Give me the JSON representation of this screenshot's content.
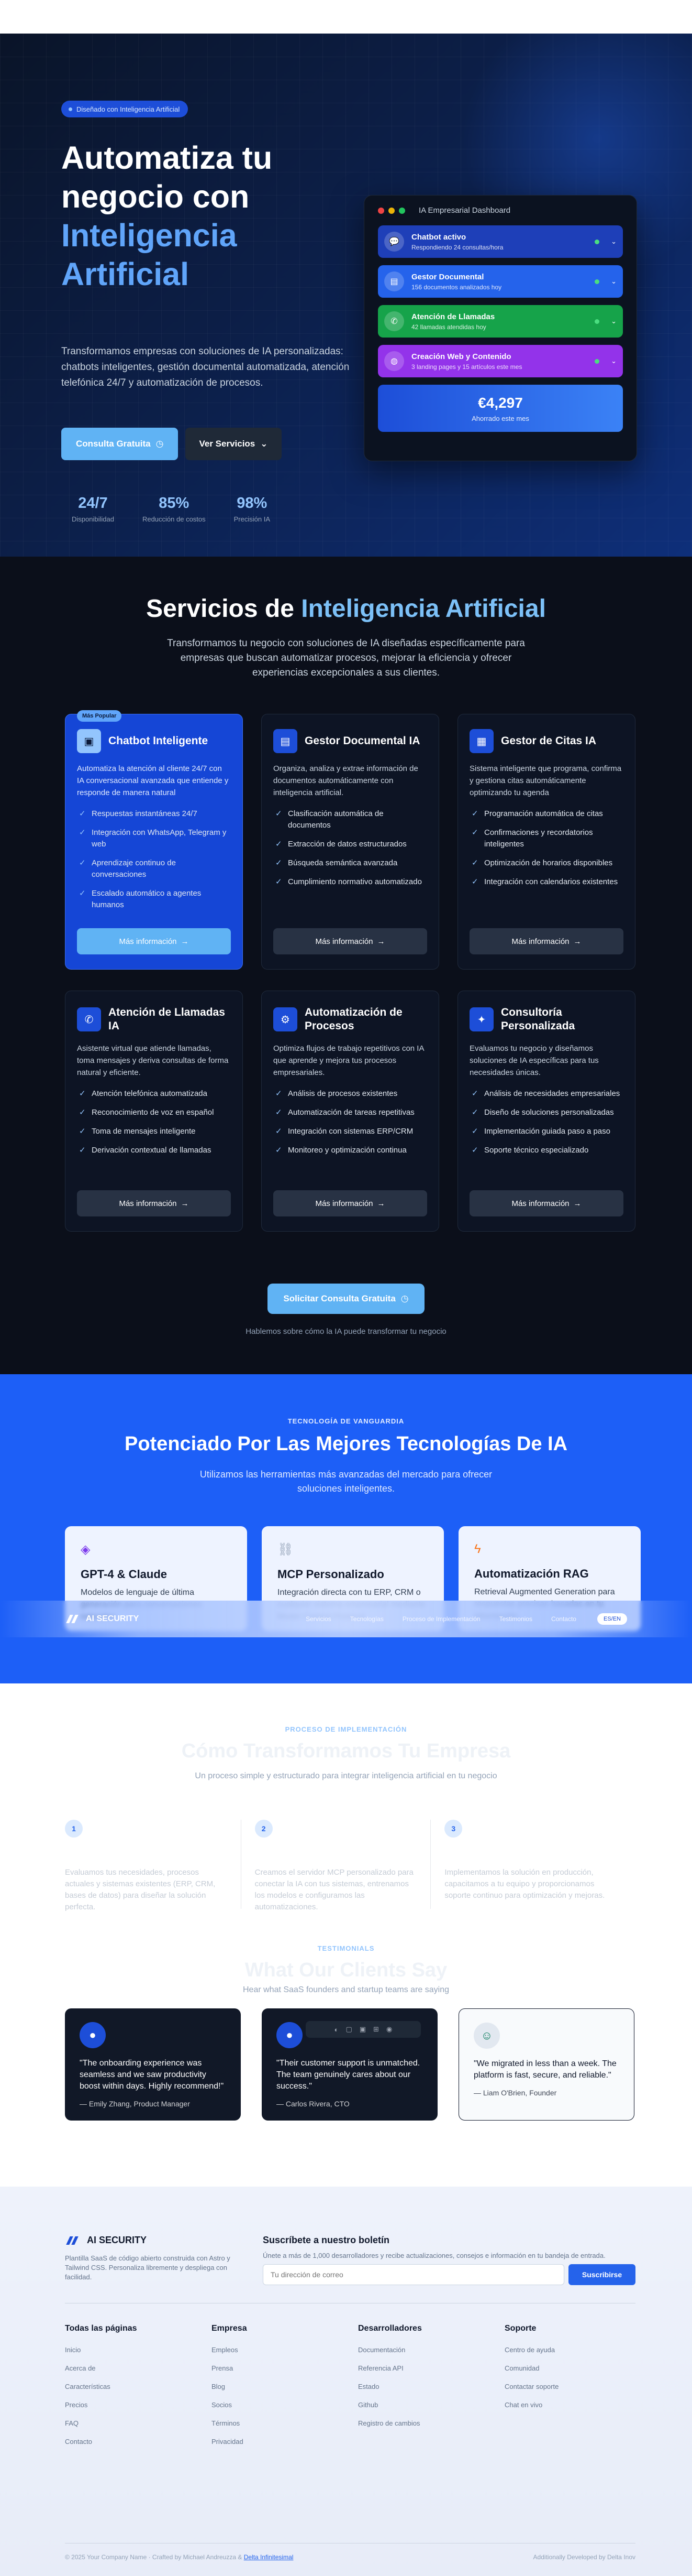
{
  "hero": {
    "badge": "Diseñado con Inteligencia Artificial",
    "title_line1": "Automatiza tu",
    "title_line2": "negocio con",
    "title_highlight1": "Inteligencia",
    "title_highlight2": "Artificial",
    "description": "Transformamos empresas con soluciones de IA personalizadas: chatbots inteligentes, gestión documental automatizada, atención telefónica 24/7 y automatización de procesos.",
    "cta_primary": "Consulta Gratuita",
    "cta_secondary": "Ver Servicios",
    "stats": [
      {
        "value": "24/7",
        "label": "Disponibilidad"
      },
      {
        "value": "85%",
        "label": "Reducción de costos"
      },
      {
        "value": "98%",
        "label": "Precisión IA"
      }
    ]
  },
  "dashboard": {
    "title": "IA Empresarial Dashboard",
    "rows": [
      {
        "title": "Chatbot activo",
        "sub": "Respondiendo 24 consultas/hora",
        "color": "#1e3fb8",
        "icon": "chat-icon"
      },
      {
        "title": "Gestor Documental",
        "sub": "156 documentos analizados hoy",
        "color": "#2563eb",
        "icon": "document-icon"
      },
      {
        "title": "Atención de Llamadas",
        "sub": "42 llamadas atendidas hoy",
        "color": "#16a34a",
        "icon": "phone-icon"
      },
      {
        "title": "Creación Web y Contenido",
        "sub": "3 landing pages y 15 artículos este mes",
        "color": "#9333ea",
        "icon": "globe-icon"
      }
    ],
    "total_value": "€4,297",
    "total_label": "Ahorrado este mes"
  },
  "services": {
    "title_plain": "Servicios de ",
    "title_highlight": "Inteligencia Artificial",
    "subtitle": "Transformamos tu negocio con soluciones de IA diseñadas específicamente para empresas que buscan automatizar procesos, mejorar la eficiencia y ofrecer experiencias excepcionales a sus clientes.",
    "more_label": "Más información",
    "popular_label": "Más Popular",
    "cards": [
      {
        "title": "Chatbot Inteligente",
        "icon": "chatbot-icon",
        "desc": "Automatiza la atención al cliente 24/7 con IA conversacional avanzada que entiende y responde de manera natural",
        "items": [
          "Respuestas instantáneas 24/7",
          "Integración con WhatsApp, Telegram y web",
          "Aprendizaje continuo de conversaciones",
          "Escalado automático a agentes humanos"
        ]
      },
      {
        "title": "Gestor Documental IA",
        "icon": "document-icon",
        "desc": "Organiza, analiza y extrae información de documentos automáticamente con inteligencia artificial.",
        "items": [
          "Clasificación automática de documentos",
          "Extracción de datos estructurados",
          "Búsqueda semántica avanzada",
          "Cumplimiento normativo automatizado"
        ]
      },
      {
        "title": "Gestor de Citas IA",
        "icon": "calendar-icon",
        "desc": "Sistema inteligente que programa, confirma y gestiona citas automáticamente optimizando tu agenda",
        "items": [
          "Programación automática de citas",
          "Confirmaciones y recordatorios inteligentes",
          "Optimización de horarios disponibles",
          "Integración con calendarios existentes"
        ]
      },
      {
        "title": "Atención de Llamadas IA",
        "icon": "phone-icon",
        "desc": "Asistente virtual que atiende llamadas, toma mensajes y deriva consultas de forma natural y eficiente.",
        "items": [
          "Atención telefónica automatizada",
          "Reconocimiento de voz en español",
          "Toma de mensajes inteligente",
          "Derivación contextual de llamadas"
        ]
      },
      {
        "title": "Automatización de Procesos",
        "icon": "gear-icon",
        "desc": "Optimiza flujos de trabajo repetitivos con IA que aprende y mejora tus procesos empresariales.",
        "items": [
          "Análisis de procesos existentes",
          "Automatización de tareas repetitivas",
          "Integración con sistemas ERP/CRM",
          "Monitoreo y optimización continua"
        ]
      },
      {
        "title": "Consultoría Personalizada",
        "icon": "lightbulb-icon",
        "desc": "Evaluamos tu negocio y diseñamos soluciones de IA específicas para tus necesidades únicas.",
        "items": [
          "Análisis de necesidades empresariales",
          "Diseño de soluciones personalizadas",
          "Implementación guiada paso a paso",
          "Soporte técnico especializado"
        ]
      }
    ],
    "cta": "Solicitar Consulta Gratuita",
    "cta_sub": "Hablemos sobre cómo la IA puede transformar tu negocio"
  },
  "tech": {
    "kicker": "TECNOLOGÍA DE VANGUARDIA",
    "title": "Potenciado Por Las Mejores Tecnologías De IA",
    "subtitle": "Utilizamos las herramientas más avanzadas del mercado para ofrecer soluciones inteligentes.",
    "cards": [
      {
        "title": "GPT-4 & Claude",
        "icon": "robot-icon",
        "desc": "Modelos de lenguaje de última generación para conversaciones naturales."
      },
      {
        "title": "MCP Personalizado",
        "icon": "link-icon",
        "desc": "Integración directa con tu ERP, CRM o cualquier sistema empresarial mediante Model Context Protocol."
      },
      {
        "title": "Automatización RAG",
        "icon": "bolt-icon",
        "desc": "Retrieval Augmented Generation para respuestas precisas basadas en tu información."
      }
    ]
  },
  "navbar": {
    "brand": "AI SECURITY",
    "links": [
      "Servicios",
      "Tecnologías",
      "Proceso de Implementación",
      "Testimonios",
      "Contacto"
    ],
    "lang": "ES/EN"
  },
  "process": {
    "kicker": "PROCESO DE IMPLEMENTACIÓN",
    "title": "Cómo Transformamos Tu Empresa",
    "subtitle": "Un proceso simple y estructurado para integrar inteligencia artificial en tu negocio",
    "steps": [
      {
        "n": "1",
        "desc": "Evaluamos tus necesidades, procesos actuales y sistemas existentes (ERP, CRM, bases de datos) para diseñar la solución perfecta."
      },
      {
        "n": "2",
        "desc": "Creamos el servidor MCP personalizado para conectar la IA con tus sistemas, entrenamos los modelos e configuramos las automatizaciones."
      },
      {
        "n": "3",
        "desc": "Implementamos la solución en producción, capacitamos a tu equipo y proporcionamos soporte continuo para optimización y mejoras."
      }
    ]
  },
  "testimonials": {
    "kicker": "TESTIMONIALS",
    "title": "What Our Clients Say",
    "subtitle": "Hear what SaaS founders and startup teams are saying",
    "items": [
      {
        "quote": "\"The onboarding experience was seamless and we saw productivity boost within days. Highly recommend!\"",
        "author": "— Emily Zhang, Product Manager",
        "icon": "user-icon"
      },
      {
        "quote": "\"Their customer support is unmatched. The team genuinely cares about our success.\"",
        "author": "— Carlos Rivera, CTO",
        "icon": "user-icon"
      },
      {
        "quote": "\"We migrated in less than a week. The platform is fast, secure, and reliable.\"",
        "author": "— Liam O'Brien, Founder",
        "icon": "user-icon"
      }
    ]
  },
  "footer": {
    "brand": "AI SECURITY",
    "desc": "Plantilla SaaS de código abierto construida con Astro y Tailwind CSS. Personaliza libremente y despliega con facilidad.",
    "newsletter_title": "Suscríbete a nuestro boletín",
    "newsletter_sub": "Únete a más de 1,000 desarrolladores y recibe actualizaciones, consejos e información en tu bandeja de entrada.",
    "newsletter_placeholder": "Tu dirección de correo",
    "newsletter_btn": "Suscribirse",
    "cols": [
      {
        "title": "Todas las páginas",
        "links": [
          "Inicio",
          "Acerca de",
          "Características",
          "Precios",
          "FAQ",
          "Contacto"
        ]
      },
      {
        "title": "Empresa",
        "links": [
          "Empleos",
          "Prensa",
          "Blog",
          "Socios",
          "Términos",
          "Privacidad"
        ]
      },
      {
        "title": "Desarrolladores",
        "links": [
          "Documentación",
          "Referencia API",
          "Estado",
          "Github",
          "Registro de cambios"
        ]
      },
      {
        "title": "Soporte",
        "links": [
          "Centro de ayuda",
          "Comunidad",
          "Contactar soporte",
          "Chat en vivo"
        ]
      }
    ],
    "copyright": "© 2025 Your Company Name · Crafted by Michael Andreuzza &",
    "copyright_link": "Delta Infinitesimal",
    "right": "Additionally Developed by Delta Inov"
  }
}
